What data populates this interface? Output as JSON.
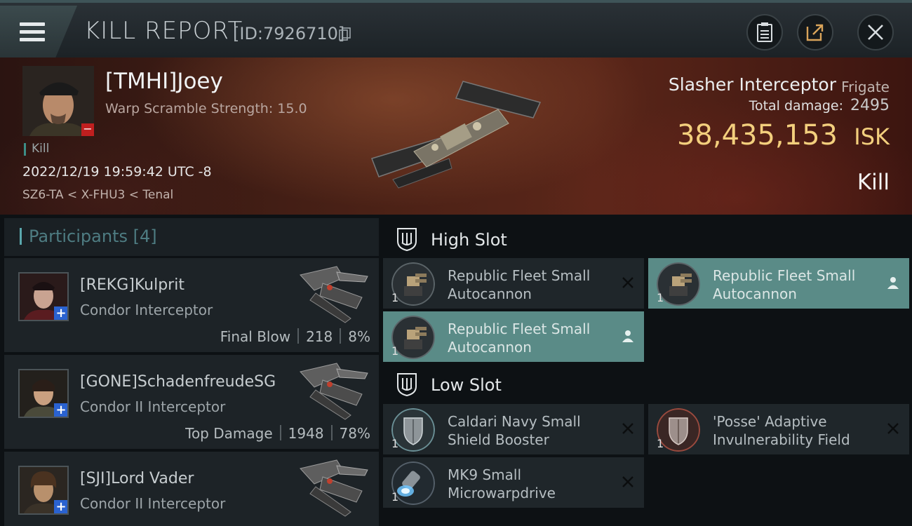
{
  "header": {
    "title": "KILL REPORT",
    "report_id": "[ID:7926710]",
    "icons": [
      "menu-icon",
      "copy-icon",
      "clipboard-icon",
      "share-icon",
      "close-icon"
    ]
  },
  "victim": {
    "name": "[TMHI]Joey",
    "scramble": "Warp Scramble Strength: 15.0",
    "kill_tag": "Kill",
    "datetime": "2022/12/19 19:59:42 UTC -8",
    "location": "SZ6-TA < X-FHU3 < Tenal",
    "ship_name": "Slasher Interceptor",
    "ship_class": "Frigate",
    "damage_label": "Total damage:",
    "damage_value": "2495",
    "isk_value": "38,435,153",
    "isk_unit": "ISK",
    "outcome": "Kill"
  },
  "participants": {
    "title": "Participants",
    "count": "[4]",
    "rows": [
      {
        "name": "[REKG]Kulprit",
        "ship": "Condor Interceptor",
        "label": "Final Blow",
        "damage": "218",
        "percent": "8%"
      },
      {
        "name": "[GONE]SchadenfreudeSG",
        "ship": "Condor II Interceptor",
        "label": "Top Damage",
        "damage": "1948",
        "percent": "78%"
      },
      {
        "name": "[SJI]Lord Vader",
        "ship": "Condor II Interceptor"
      }
    ]
  },
  "fittings": {
    "high_slot": {
      "title": "High Slot",
      "modules": [
        {
          "name_line1": "Republic Fleet Small",
          "name_line2": "Autocannon",
          "qty": "1",
          "state": "destroyed"
        },
        {
          "name_line1": "Republic Fleet Small",
          "name_line2": "Autocannon",
          "qty": "1",
          "state": "dropped"
        },
        {
          "name_line1": "Republic Fleet Small",
          "name_line2": "Autocannon",
          "qty": "1",
          "state": "dropped"
        }
      ]
    },
    "low_slot": {
      "title": "Low Slot",
      "modules": [
        {
          "name_line1": "Caldari Navy Small",
          "name_line2": "Shield Booster",
          "qty": "1",
          "state": "destroyed"
        },
        {
          "name_line1": "'Posse' Adaptive",
          "name_line2": "Invulnerability Field",
          "qty": "1",
          "state": "destroyed"
        },
        {
          "name_line1": "MK9 Small",
          "name_line2": "Microwarpdrive",
          "qty": "1",
          "state": "destroyed"
        }
      ]
    }
  },
  "colors": {
    "isk": "#f3cf7d",
    "accent": "#5aa7ad",
    "dropped_bg": "#5a8b87",
    "minus_badge": "#c01f1f",
    "plus_badge": "#2a62d0"
  }
}
